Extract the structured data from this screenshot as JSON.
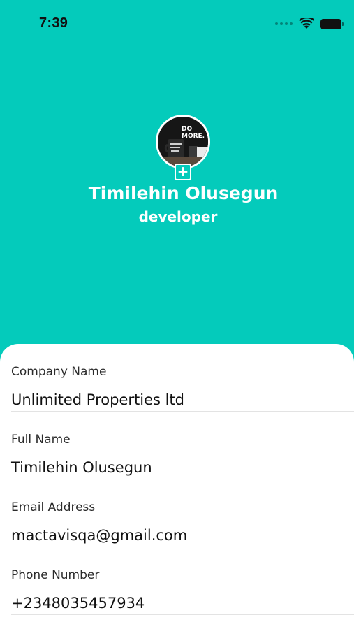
{
  "status_bar": {
    "time": "7:39"
  },
  "profile": {
    "name": "Timilehin Olusegun",
    "role": "developer",
    "add_photo_label": "+"
  },
  "fields": [
    {
      "label": "Company Name",
      "value": "Unlimited Properties ltd"
    },
    {
      "label": "Full Name",
      "value": "Timilehin Olusegun"
    },
    {
      "label": "Email Address",
      "value": "mactavisqa@gmail.com"
    },
    {
      "label": "Phone Number",
      "value": "+2348035457934"
    }
  ],
  "colors": {
    "accent": "#04CBBB",
    "background": "#ffffff"
  }
}
